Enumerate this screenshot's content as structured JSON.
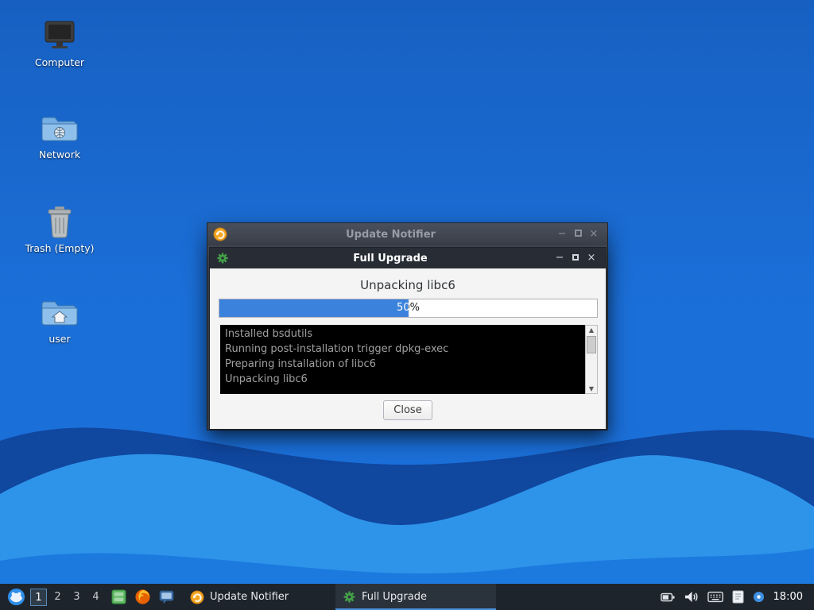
{
  "desktop": {
    "icons": [
      {
        "label": "Computer"
      },
      {
        "label": "Network"
      },
      {
        "label": "Trash (Empty)"
      },
      {
        "label": "user"
      }
    ]
  },
  "update_notifier_window": {
    "title": "Update Notifier"
  },
  "full_upgrade_dialog": {
    "title": "Full Upgrade",
    "status_text": "Unpacking libc6",
    "progress_percent": 50,
    "progress_label": "50%",
    "progress_style": "width:50%",
    "log_lines": [
      "Installed bsdutils",
      "Running post-installation trigger dpkg-exec",
      "Preparing installation of libc6",
      "Unpacking libc6"
    ],
    "close_button_label": "Close"
  },
  "taskbar": {
    "workspaces": [
      "1",
      "2",
      "3",
      "4"
    ],
    "active_workspace": "1",
    "tasks": [
      {
        "label": "Update Notifier",
        "icon": "update-notifier-icon"
      },
      {
        "label": "Full Upgrade",
        "icon": "gear-icon",
        "active": true
      }
    ],
    "clock": "18:00"
  },
  "glyphs": {
    "minimize": "−",
    "close": "×",
    "scroll_up": "▲",
    "scroll_down": "▼"
  },
  "colors": {
    "accent_blue": "#3b82dd",
    "titlebar_dark": "#282d35",
    "taskbar": "#1d242c",
    "active_indicator": "#4b8fdd"
  }
}
